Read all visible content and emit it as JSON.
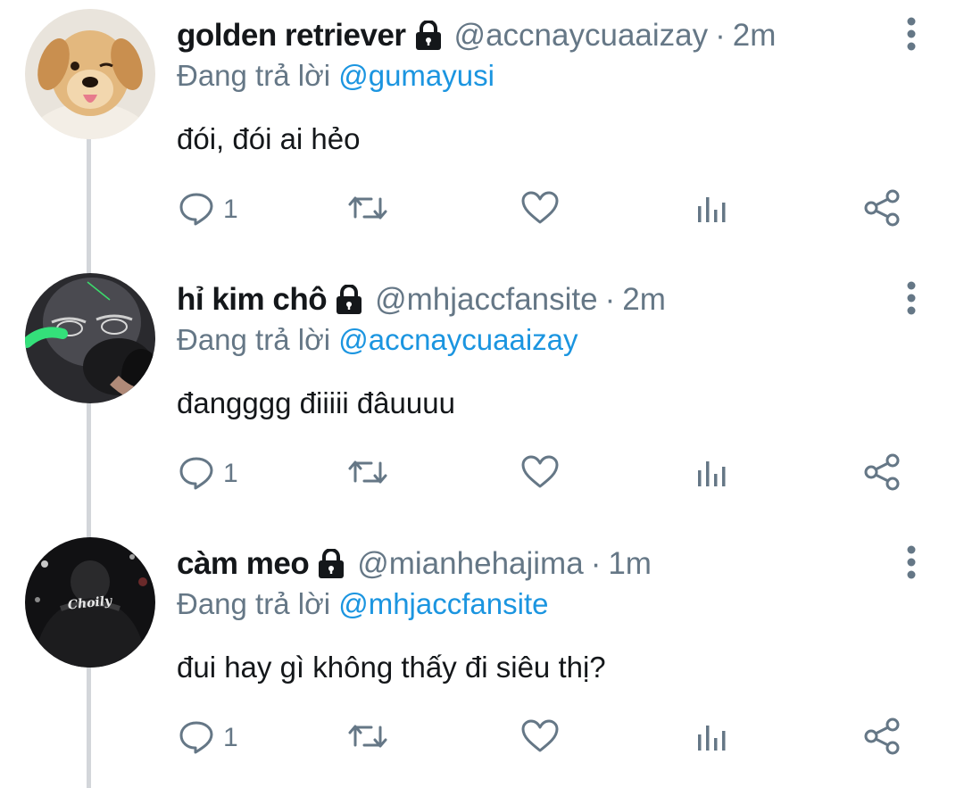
{
  "colors": {
    "text_primary": "#14171a",
    "text_secondary": "#657786",
    "link": "#1b95e0",
    "thread_line": "#d3d6da"
  },
  "icons": {
    "lock": "lock-icon",
    "more": "more-vertical-icon",
    "reply": "comment-icon",
    "retweet": "retweet-icon",
    "like": "heart-icon",
    "views": "bar-chart-icon",
    "share": "share-icon"
  },
  "tweets": [
    {
      "display_name": "golden retriever",
      "handle": "@accnaycuaaizay",
      "separator": "·",
      "time": "2m",
      "reply_prefix": "Đang trả lời",
      "reply_to": "@gumayusi",
      "text": "đói, đói ai hẻo",
      "reply_count": "1"
    },
    {
      "display_name": "hỉ kim chô",
      "handle": "@mhjaccfansite",
      "separator": "·",
      "time": "2m",
      "reply_prefix": "Đang trả lời",
      "reply_to": "@accnaycuaaizay",
      "text": "đangggg điiiii đâuuuu",
      "reply_count": "1"
    },
    {
      "display_name": "càm meo",
      "handle": "@mianhehajima",
      "separator": "·",
      "time": "1m",
      "reply_prefix": "Đang trả lời",
      "reply_to": "@mhjaccfansite",
      "text": "đui hay gì không thấy đi siêu thị?",
      "reply_count": "1",
      "avatar_shirt_text": "Choily"
    }
  ]
}
